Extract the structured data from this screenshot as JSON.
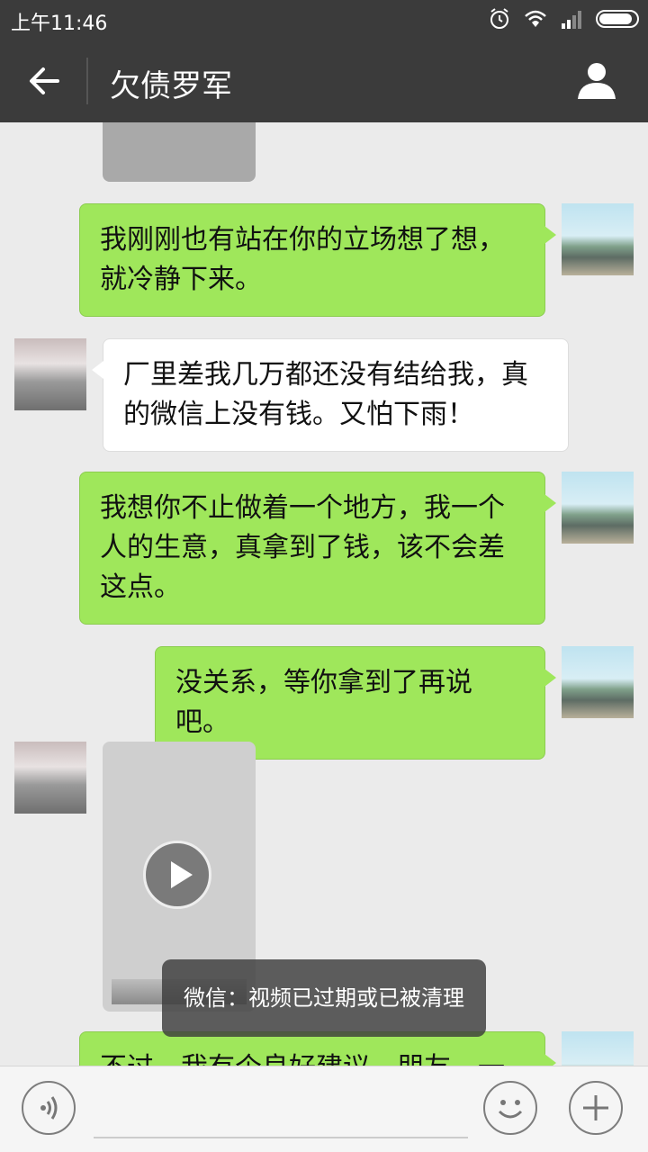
{
  "status_bar": {
    "time": "上午11:46",
    "icons": [
      "alarm-icon",
      "wifi-icon",
      "signal-icon",
      "battery-icon"
    ]
  },
  "header": {
    "title": "欠债罗军",
    "back_icon": "back-arrow-icon",
    "profile_icon": "profile-icon"
  },
  "messages": [
    {
      "from": "me",
      "text": "我刚刚也有站在你的立场想了想，就冷静下来。"
    },
    {
      "from": "them",
      "text": "厂里差我几万都还没有结给我，真的微信上没有钱。又怕下雨！"
    },
    {
      "from": "me",
      "text": "我想你不止做着一个地方，我一个人的生意，真拿到了钱，该不会差这点。"
    },
    {
      "from": "me",
      "text": "没关系，等你拿到了再说吧。"
    },
    {
      "from": "them",
      "type": "video"
    },
    {
      "from": "me",
      "text": "不过，我有个良好建议，朋友，一定"
    }
  ],
  "toast": {
    "text": "微信：视频已过期或已被清理"
  },
  "input_bar": {
    "voice_icon": "voice-icon",
    "emoji_icon": "emoji-icon",
    "plus_icon": "plus-icon"
  },
  "colors": {
    "header_bg": "#3b3b3b",
    "chat_bg": "#ebebeb",
    "my_bubble": "#9fe75b",
    "their_bubble": "#ffffff"
  }
}
